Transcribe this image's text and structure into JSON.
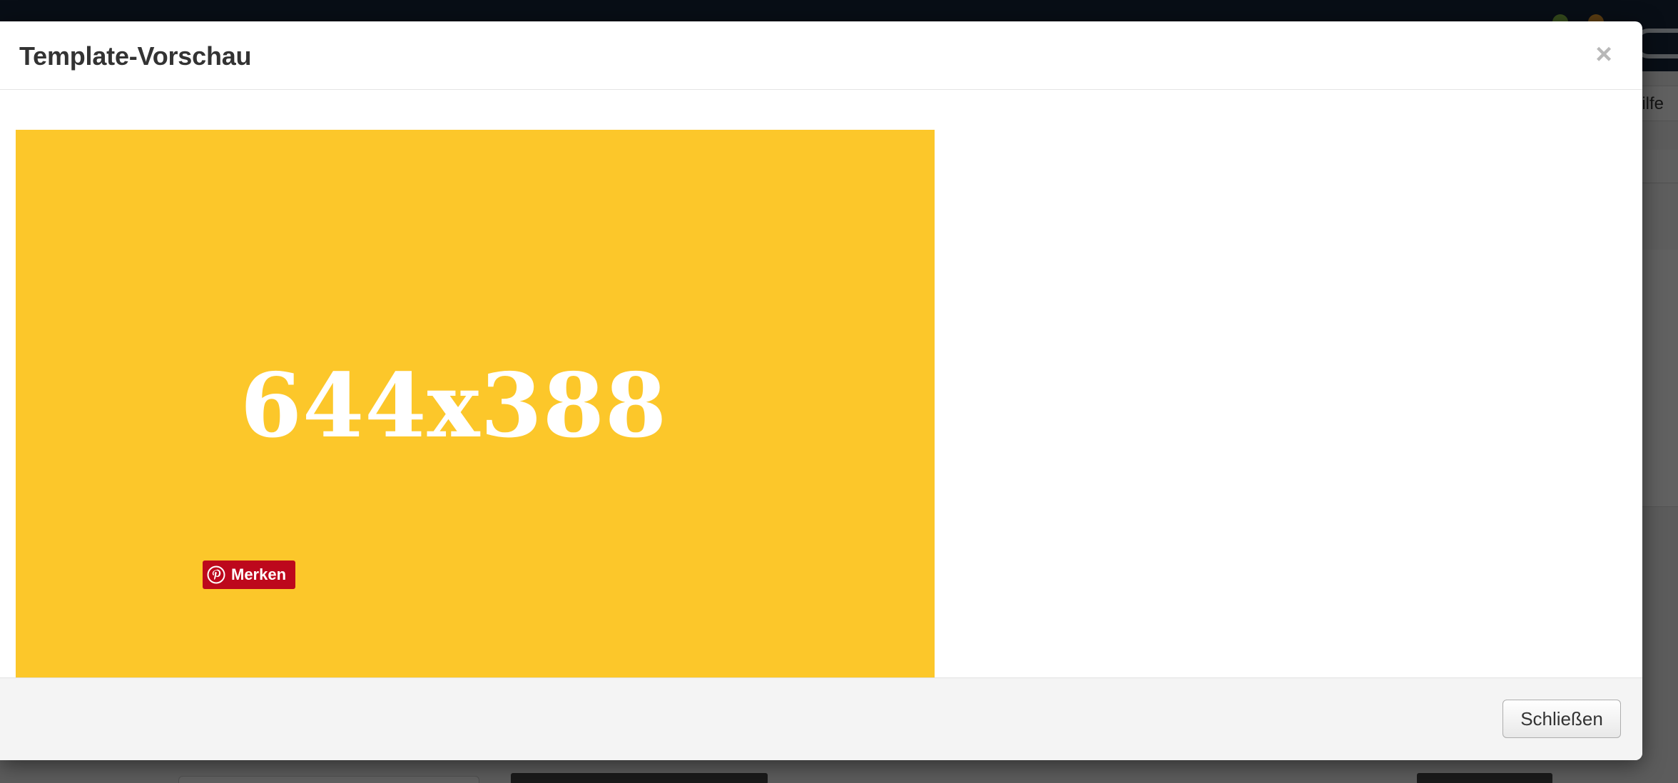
{
  "background": {
    "menu_text_fragment": "ilfe"
  },
  "modal": {
    "title": "Template-Vorschau",
    "close_icon_glyph": "×",
    "preview": {
      "dimensions_text": "644x388",
      "background_color": "#fcc72a",
      "pin_button_label": "Merken",
      "pin_button_color": "#bd081c"
    },
    "footer": {
      "close_button_label": "Schließen"
    }
  }
}
